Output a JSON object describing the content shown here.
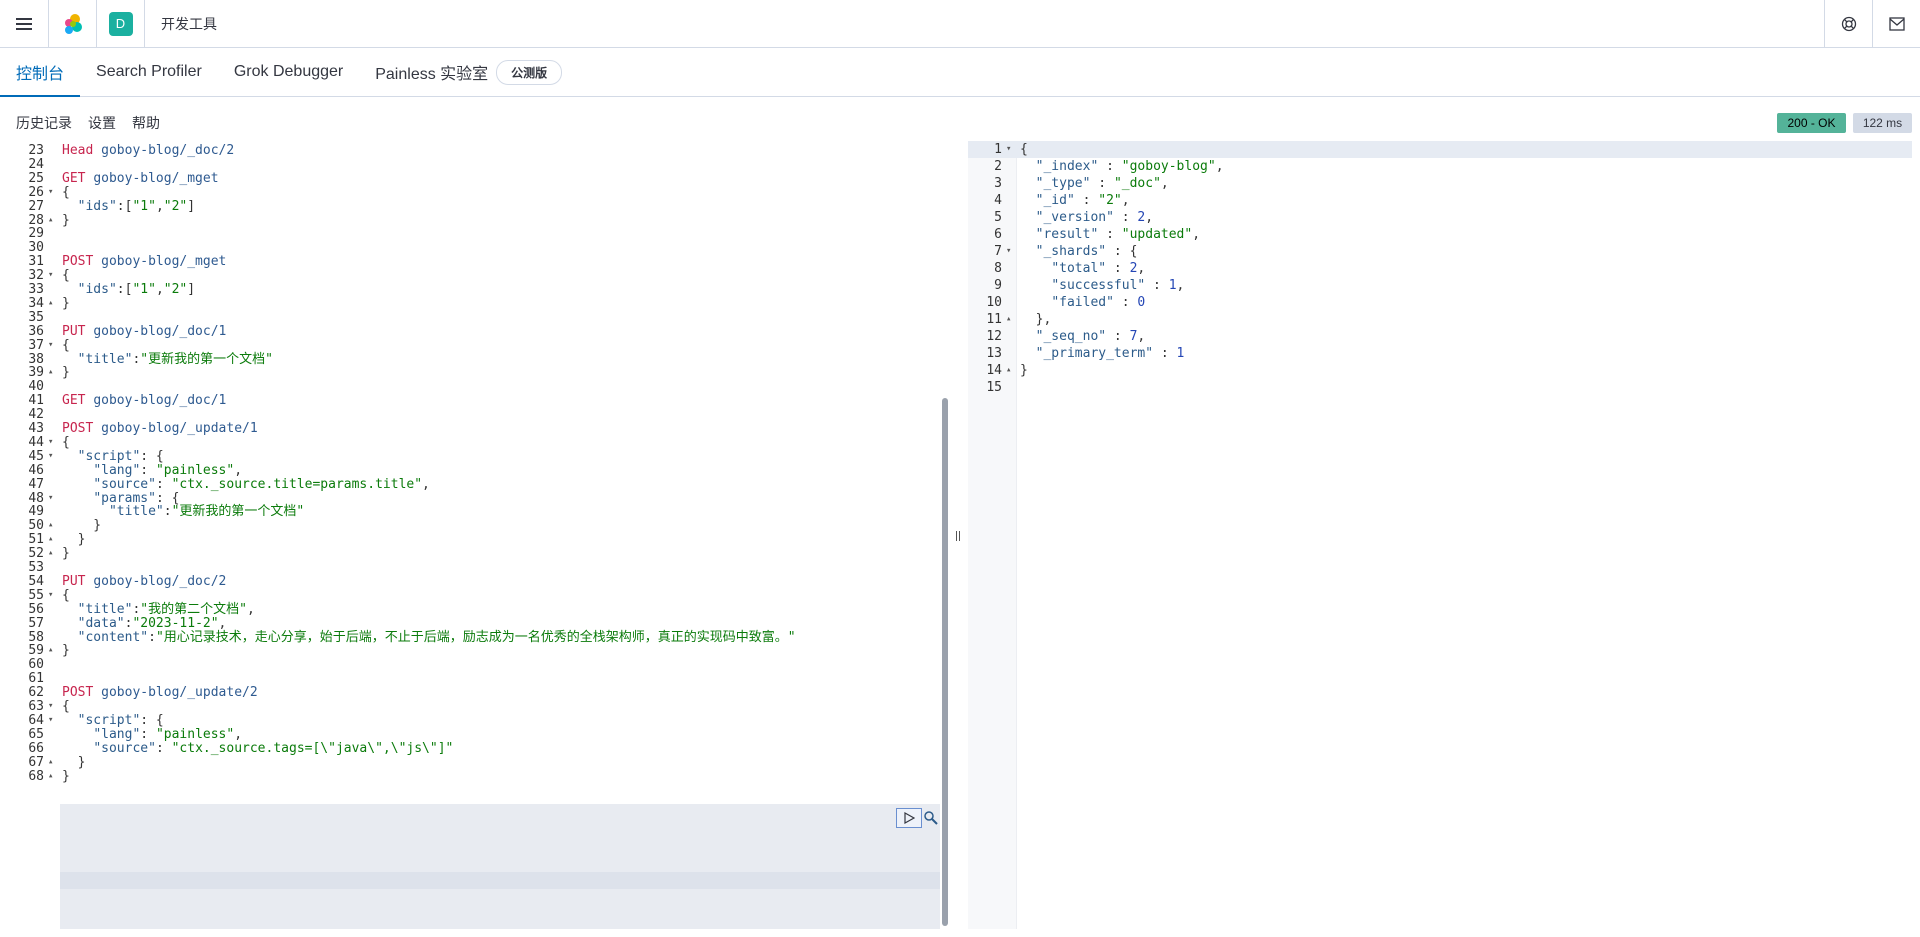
{
  "header": {
    "breadcrumb": "开发工具",
    "space_initial": "D",
    "icons": [
      "menu-icon",
      "elastic-logo-icon",
      "help-icon",
      "newsfeed-icon"
    ]
  },
  "tabs": [
    {
      "label": "控制台",
      "active": true
    },
    {
      "label": "Search Profiler",
      "active": false
    },
    {
      "label": "Grok Debugger",
      "active": false
    },
    {
      "label": "Painless 实验室",
      "active": false
    }
  ],
  "beta_badge": "公测版",
  "toolbar": {
    "history": "历史记录",
    "settings": "设置",
    "help": "帮助"
  },
  "status": {
    "code": "200 - OK",
    "time": "122 ms"
  },
  "colors": {
    "accent": "#006bb8",
    "status_ok": "#54b399",
    "method": "#c7254e",
    "string": "#0b7b0b"
  },
  "request_lines": [
    {
      "n": "23",
      "fold": "",
      "t": [
        [
          "m",
          "Head "
        ],
        [
          "u",
          "goboy-blog/_doc/2"
        ]
      ]
    },
    {
      "n": "24",
      "fold": "",
      "t": []
    },
    {
      "n": "25",
      "fold": "",
      "t": [
        [
          "m",
          "GET "
        ],
        [
          "u",
          "goboy-blog/_mget"
        ]
      ]
    },
    {
      "n": "26",
      "fold": "▾",
      "t": [
        [
          "p",
          "{"
        ]
      ]
    },
    {
      "n": "27",
      "fold": "",
      "t": [
        [
          "p",
          "  "
        ],
        [
          "k",
          "\"ids\""
        ],
        [
          "p",
          ":["
        ],
        [
          "s",
          "\"1\""
        ],
        [
          "p",
          ","
        ],
        [
          "s",
          "\"2\""
        ],
        [
          "p",
          "]"
        ]
      ]
    },
    {
      "n": "28",
      "fold": "▴",
      "t": [
        [
          "p",
          "}"
        ]
      ]
    },
    {
      "n": "29",
      "fold": "",
      "t": []
    },
    {
      "n": "30",
      "fold": "",
      "t": []
    },
    {
      "n": "31",
      "fold": "",
      "t": [
        [
          "m",
          "POST "
        ],
        [
          "u",
          "goboy-blog/_mget"
        ]
      ]
    },
    {
      "n": "32",
      "fold": "▾",
      "t": [
        [
          "p",
          "{"
        ]
      ]
    },
    {
      "n": "33",
      "fold": "",
      "t": [
        [
          "p",
          "  "
        ],
        [
          "k",
          "\"ids\""
        ],
        [
          "p",
          ":["
        ],
        [
          "s",
          "\"1\""
        ],
        [
          "p",
          ","
        ],
        [
          "s",
          "\"2\""
        ],
        [
          "p",
          "]"
        ]
      ]
    },
    {
      "n": "34",
      "fold": "▴",
      "t": [
        [
          "p",
          "}"
        ]
      ]
    },
    {
      "n": "35",
      "fold": "",
      "t": []
    },
    {
      "n": "36",
      "fold": "",
      "t": [
        [
          "m",
          "PUT "
        ],
        [
          "u",
          "goboy-blog/_doc/1"
        ]
      ]
    },
    {
      "n": "37",
      "fold": "▾",
      "t": [
        [
          "p",
          "{"
        ]
      ]
    },
    {
      "n": "38",
      "fold": "",
      "t": [
        [
          "p",
          "  "
        ],
        [
          "k",
          "\"title\""
        ],
        [
          "p",
          ":"
        ],
        [
          "s",
          "\"更新我的第一个文档\""
        ]
      ]
    },
    {
      "n": "39",
      "fold": "▴",
      "t": [
        [
          "p",
          "}"
        ]
      ]
    },
    {
      "n": "40",
      "fold": "",
      "t": []
    },
    {
      "n": "41",
      "fold": "",
      "t": [
        [
          "m",
          "GET "
        ],
        [
          "u",
          "goboy-blog/_doc/1"
        ]
      ]
    },
    {
      "n": "42",
      "fold": "",
      "t": []
    },
    {
      "n": "43",
      "fold": "",
      "t": [
        [
          "m",
          "POST "
        ],
        [
          "u",
          "goboy-blog/_update/1"
        ]
      ]
    },
    {
      "n": "44",
      "fold": "▾",
      "t": [
        [
          "p",
          "{"
        ]
      ]
    },
    {
      "n": "45",
      "fold": "▾",
      "t": [
        [
          "p",
          "  "
        ],
        [
          "k",
          "\"script\""
        ],
        [
          "p",
          ": {"
        ]
      ]
    },
    {
      "n": "46",
      "fold": "",
      "t": [
        [
          "p",
          "    "
        ],
        [
          "k",
          "\"lang\""
        ],
        [
          "p",
          ": "
        ],
        [
          "s",
          "\"painless\""
        ],
        [
          "p",
          ","
        ]
      ]
    },
    {
      "n": "47",
      "fold": "",
      "t": [
        [
          "p",
          "    "
        ],
        [
          "k",
          "\"source\""
        ],
        [
          "p",
          ": "
        ],
        [
          "s",
          "\"ctx._source.title=params.title\""
        ],
        [
          "p",
          ","
        ]
      ]
    },
    {
      "n": "48",
      "fold": "▾",
      "t": [
        [
          "p",
          "    "
        ],
        [
          "k",
          "\"params\""
        ],
        [
          "p",
          ": {"
        ]
      ]
    },
    {
      "n": "49",
      "fold": "",
      "t": [
        [
          "p",
          "      "
        ],
        [
          "k",
          "\"title\""
        ],
        [
          "p",
          ":"
        ],
        [
          "s",
          "\"更新我的第一个文档\""
        ]
      ]
    },
    {
      "n": "50",
      "fold": "▴",
      "t": [
        [
          "p",
          "    }"
        ]
      ]
    },
    {
      "n": "51",
      "fold": "▴",
      "t": [
        [
          "p",
          "  }"
        ]
      ]
    },
    {
      "n": "52",
      "fold": "▴",
      "t": [
        [
          "p",
          "}"
        ]
      ]
    },
    {
      "n": "53",
      "fold": "",
      "t": []
    },
    {
      "n": "54",
      "fold": "",
      "t": [
        [
          "m",
          "PUT "
        ],
        [
          "u",
          "goboy-blog/_doc/2"
        ]
      ]
    },
    {
      "n": "55",
      "fold": "▾",
      "t": [
        [
          "p",
          "{"
        ]
      ]
    },
    {
      "n": "56",
      "fold": "",
      "t": [
        [
          "p",
          "  "
        ],
        [
          "k",
          "\"title\""
        ],
        [
          "p",
          ":"
        ],
        [
          "s",
          "\"我的第二个文档\""
        ],
        [
          "p",
          ","
        ]
      ]
    },
    {
      "n": "57",
      "fold": "",
      "t": [
        [
          "p",
          "  "
        ],
        [
          "k",
          "\"data\""
        ],
        [
          "p",
          ":"
        ],
        [
          "s",
          "\"2023-11-2\""
        ],
        [
          "p",
          ","
        ]
      ]
    },
    {
      "n": "58",
      "fold": "",
      "t": [
        [
          "p",
          "  "
        ],
        [
          "k",
          "\"content\""
        ],
        [
          "p",
          ":"
        ],
        [
          "s",
          "\"用心记录技术，走心分享，始于后端，不止于后端，励志成为一名优秀的全栈架构师，真正的实现码中致富。\""
        ]
      ]
    },
    {
      "n": "59",
      "fold": "▴",
      "t": [
        [
          "p",
          "}"
        ]
      ]
    },
    {
      "n": "60",
      "fold": "",
      "t": []
    },
    {
      "n": "61",
      "fold": "",
      "t": []
    },
    {
      "n": "62",
      "fold": "",
      "t": [
        [
          "m",
          "POST "
        ],
        [
          "u",
          "goboy-blog/_update/2"
        ]
      ]
    },
    {
      "n": "63",
      "fold": "▾",
      "t": [
        [
          "p",
          "{"
        ]
      ]
    },
    {
      "n": "64",
      "fold": "▾",
      "t": [
        [
          "p",
          "  "
        ],
        [
          "k",
          "\"script\""
        ],
        [
          "p",
          ": {"
        ]
      ]
    },
    {
      "n": "65",
      "fold": "",
      "t": [
        [
          "p",
          "    "
        ],
        [
          "k",
          "\"lang\""
        ],
        [
          "p",
          ": "
        ],
        [
          "s",
          "\"painless\""
        ],
        [
          "p",
          ","
        ]
      ]
    },
    {
      "n": "66",
      "fold": "",
      "t": [
        [
          "p",
          "    "
        ],
        [
          "k",
          "\"source\""
        ],
        [
          "p",
          ": "
        ],
        [
          "s",
          "\"ctx._source.tags=[\\\"java\\\",\\\"js\\\"]\""
        ]
      ]
    },
    {
      "n": "67",
      "fold": "▴",
      "t": [
        [
          "p",
          "  }"
        ]
      ]
    },
    {
      "n": "68",
      "fold": "▴",
      "t": [
        [
          "p",
          "}"
        ]
      ]
    }
  ],
  "response_lines": [
    {
      "n": "1",
      "fold": "▾",
      "t": [
        [
          "p",
          "{"
        ]
      ]
    },
    {
      "n": "2",
      "fold": "",
      "t": [
        [
          "p",
          "  "
        ],
        [
          "k",
          "\"_index\""
        ],
        [
          "p",
          " : "
        ],
        [
          "s",
          "\"goboy-blog\""
        ],
        [
          "p",
          ","
        ]
      ]
    },
    {
      "n": "3",
      "fold": "",
      "t": [
        [
          "p",
          "  "
        ],
        [
          "k",
          "\"_type\""
        ],
        [
          "p",
          " : "
        ],
        [
          "s",
          "\"_doc\""
        ],
        [
          "p",
          ","
        ]
      ]
    },
    {
      "n": "4",
      "fold": "",
      "t": [
        [
          "p",
          "  "
        ],
        [
          "k",
          "\"_id\""
        ],
        [
          "p",
          " : "
        ],
        [
          "s",
          "\"2\""
        ],
        [
          "p",
          ","
        ]
      ]
    },
    {
      "n": "5",
      "fold": "",
      "t": [
        [
          "p",
          "  "
        ],
        [
          "k",
          "\"_version\""
        ],
        [
          "p",
          " : "
        ],
        [
          "n",
          "2"
        ],
        [
          "p",
          ","
        ]
      ]
    },
    {
      "n": "6",
      "fold": "",
      "t": [
        [
          "p",
          "  "
        ],
        [
          "k",
          "\"result\""
        ],
        [
          "p",
          " : "
        ],
        [
          "s",
          "\"updated\""
        ],
        [
          "p",
          ","
        ]
      ]
    },
    {
      "n": "7",
      "fold": "▾",
      "t": [
        [
          "p",
          "  "
        ],
        [
          "k",
          "\"_shards\""
        ],
        [
          "p",
          " : {"
        ]
      ]
    },
    {
      "n": "8",
      "fold": "",
      "t": [
        [
          "p",
          "    "
        ],
        [
          "k",
          "\"total\""
        ],
        [
          "p",
          " : "
        ],
        [
          "n",
          "2"
        ],
        [
          "p",
          ","
        ]
      ]
    },
    {
      "n": "9",
      "fold": "",
      "t": [
        [
          "p",
          "    "
        ],
        [
          "k",
          "\"successful\""
        ],
        [
          "p",
          " : "
        ],
        [
          "n",
          "1"
        ],
        [
          "p",
          ","
        ]
      ]
    },
    {
      "n": "10",
      "fold": "",
      "t": [
        [
          "p",
          "    "
        ],
        [
          "k",
          "\"failed\""
        ],
        [
          "p",
          " : "
        ],
        [
          "n",
          "0"
        ]
      ]
    },
    {
      "n": "11",
      "fold": "▴",
      "t": [
        [
          "p",
          "  },"
        ]
      ]
    },
    {
      "n": "12",
      "fold": "",
      "t": [
        [
          "p",
          "  "
        ],
        [
          "k",
          "\"_seq_no\""
        ],
        [
          "p",
          " : "
        ],
        [
          "n",
          "7"
        ],
        [
          "p",
          ","
        ]
      ]
    },
    {
      "n": "13",
      "fold": "",
      "t": [
        [
          "p",
          "  "
        ],
        [
          "k",
          "\"_primary_term\""
        ],
        [
          "p",
          " : "
        ],
        [
          "n",
          "1"
        ]
      ]
    },
    {
      "n": "14",
      "fold": "▴",
      "t": [
        [
          "p",
          "}"
        ]
      ]
    },
    {
      "n": "15",
      "fold": "",
      "t": []
    }
  ]
}
